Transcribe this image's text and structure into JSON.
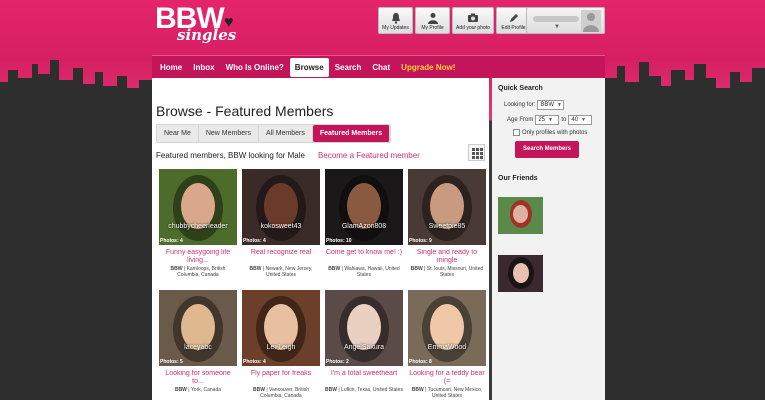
{
  "header": {
    "logo_top": "BBW",
    "logo_bottom": "singles",
    "buttons": [
      {
        "label": "My Updates",
        "icon": "bell-icon"
      },
      {
        "label": "My Profile",
        "icon": "person-icon"
      },
      {
        "label": "Add your photo",
        "icon": "camera-icon"
      },
      {
        "label": "Edit Profile",
        "icon": "pencil-icon"
      }
    ],
    "user_menu_arrow": "▼"
  },
  "nav": {
    "items": [
      "Home",
      "Inbox",
      "Who Is Online?",
      "Browse",
      "Search",
      "Chat",
      "Upgrade Now!"
    ],
    "active": "Browse"
  },
  "main": {
    "title": "Browse - Featured Members",
    "tabs": [
      "Near Me",
      "New Members",
      "All Members",
      "Featured Members"
    ],
    "active_tab": "Featured Members",
    "subheading": "Featured members, BBW looking for Male",
    "become_featured": "Become a Featured member",
    "members": [
      {
        "username": "chubbycheerleader",
        "photos": "Photos: 4",
        "headline": "Funny easygoing life living...",
        "tag": "BBW",
        "location": "Kamloops, British Columbia, Canada",
        "bg": "#4d6b2a",
        "skin": "#d9a88a"
      },
      {
        "username": "kokosweet43",
        "photos": "Photos: 4",
        "headline": "Real recognize real",
        "tag": "BBW",
        "location": "Newark, New Jersey, United States",
        "bg": "#3a2a28",
        "skin": "#6a3a2a"
      },
      {
        "username": "GlamAzon808",
        "photos": "Photos: 10",
        "headline": "Come get to know me! :)",
        "tag": "BBW",
        "location": "Wahiawa, Hawaii, United States",
        "bg": "#1a1818",
        "skin": "#8a5a40"
      },
      {
        "username": "Sweetpie85",
        "photos": "Photos: 9",
        "headline": "Single and ready to mingle",
        "tag": "BBW",
        "location": "St. louis, Missouri, United States",
        "bg": "#4a3a36",
        "skin": "#c89a80"
      },
      {
        "username": "laceyabc",
        "photos": "Photos: 5",
        "headline": "Looking for someone to...",
        "tag": "BBW",
        "location": "York, Canada",
        "bg": "#6a5a4a",
        "skin": "#e0b890"
      },
      {
        "username": "Lei-Leigh",
        "photos": "Photos: 4",
        "headline": "Fly paper for freaks",
        "tag": "BBW",
        "location": "Vancouver, British Columbia, Canada",
        "bg": "#6b3f2a",
        "skin": "#e8c0a0"
      },
      {
        "username": "AngelSakura",
        "photos": "Photos: 2",
        "headline": "I'm a total sweetheart",
        "tag": "BBW",
        "location": "Lufkin, Texas, United States",
        "bg": "#5a4a48",
        "skin": "#ead0c0"
      },
      {
        "username": "EmmaWood",
        "photos": "Photos: 8",
        "headline": "Looking for a teddy bear (=",
        "tag": "BBW",
        "location": "Tucumcari, New Mexico, United States",
        "bg": "#7a6a5a",
        "skin": "#f0c8a8"
      }
    ]
  },
  "sidebar": {
    "quick_search_title": "Quick Search",
    "looking_for_label": "Looking for:",
    "looking_for_value": "BBW",
    "age_from_label": "Age From",
    "age_from": "25",
    "age_to_label": "to",
    "age_to": "40",
    "photos_only_label": "Only profiles with photos",
    "search_button": "Search Members",
    "friends_title": "Our Friends"
  },
  "colors": {
    "brand": "#c4155a",
    "link": "#d03070",
    "upgrade": "#ffd23e"
  }
}
